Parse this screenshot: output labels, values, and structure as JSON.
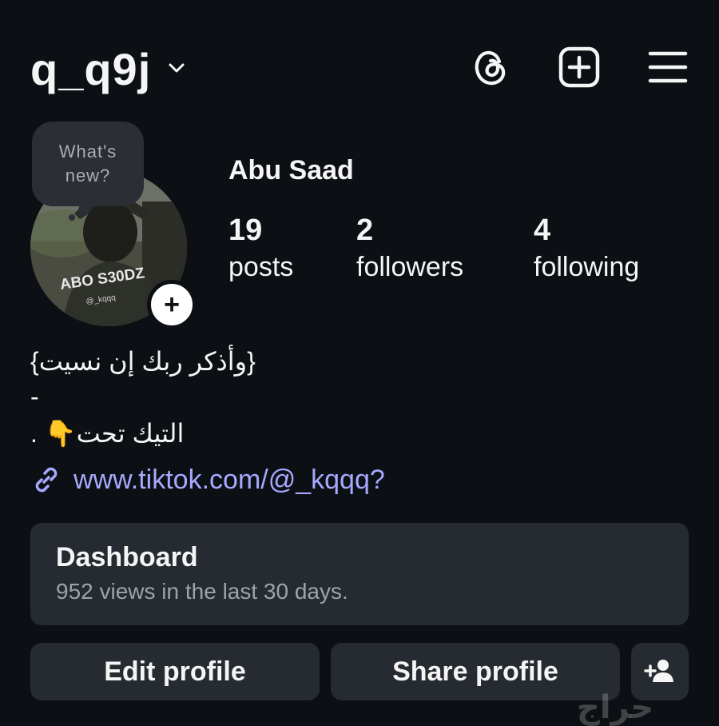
{
  "header": {
    "username": "q_q9j",
    "icons": [
      "chevron-down-icon",
      "threads-icon",
      "new-post-icon",
      "menu-icon"
    ]
  },
  "profile": {
    "note_placeholder": "What's new?",
    "display_name": "Abu Saad",
    "avatar_text": "ABO S30DZ",
    "avatar_subtext": "@_kqqq",
    "stats": [
      {
        "value": "19",
        "label": "posts"
      },
      {
        "value": "2",
        "label": "followers"
      },
      {
        "value": "4",
        "label": "following"
      }
    ]
  },
  "bio": {
    "line1": "{وأذكر ربك إن نسيت}",
    "line2": "-",
    "line3": ". 👇التيك تحت",
    "link": "www.tiktok.com/@_kqqq?"
  },
  "dashboard": {
    "title": "Dashboard",
    "subtitle": "952 views in the last 30 days."
  },
  "buttons": {
    "edit": "Edit profile",
    "share": "Share profile"
  },
  "watermark": "حراج",
  "colors": {
    "background": "#0c0f14",
    "card": "#262a31",
    "link": "#a7a9ff",
    "muted": "#9ea3ab"
  }
}
